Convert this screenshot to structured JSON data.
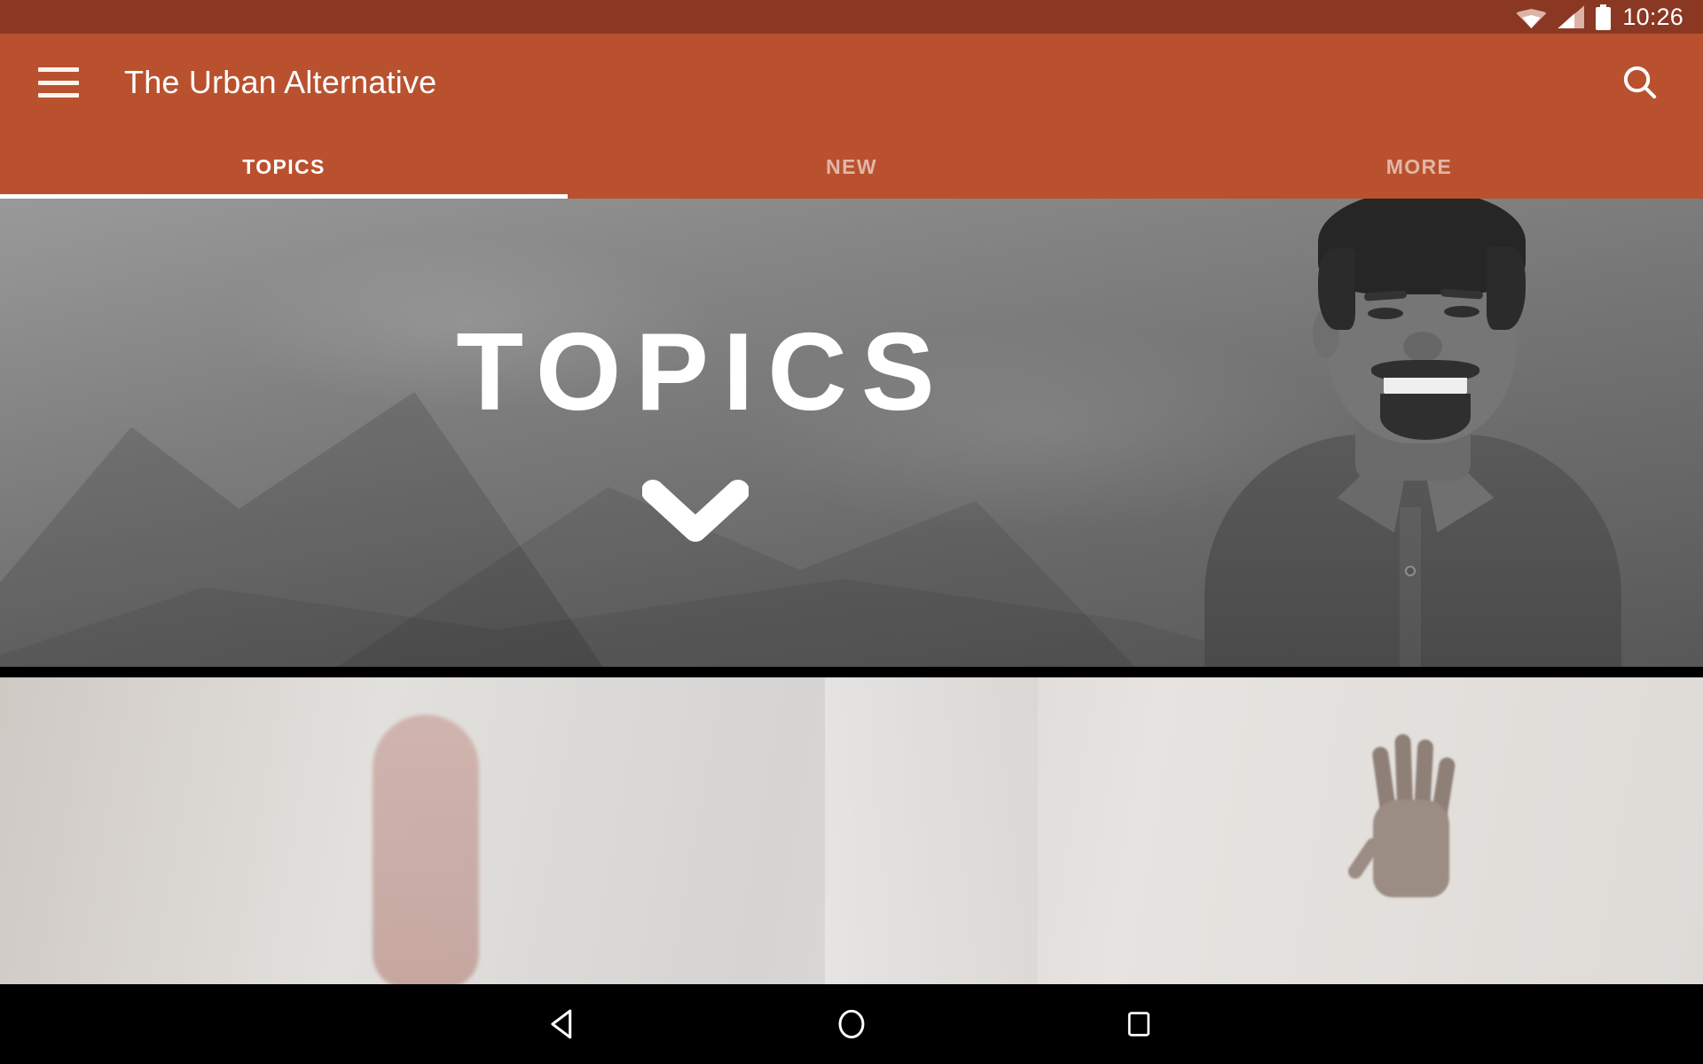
{
  "status_bar": {
    "time": "10:26",
    "icons": [
      "wifi-icon",
      "cellular-signal-icon",
      "battery-icon"
    ],
    "background_color": "#8A3823"
  },
  "app_bar": {
    "title": "The Urban Alternative",
    "menu_icon": "hamburger-menu-icon",
    "search_icon": "search-icon",
    "background_color": "#B9512F",
    "tabs": [
      {
        "label": "TOPICS",
        "active": true
      },
      {
        "label": "NEW",
        "active": false
      },
      {
        "label": "MORE",
        "active": false
      }
    ]
  },
  "hero": {
    "title": "TOPICS",
    "expand_icon": "chevron-down-icon",
    "image_description": "grayscale mountain landscape with portrait of smiling man"
  },
  "second_card": {
    "image_description": "washed out light photo with raised hand"
  },
  "nav_bar": {
    "buttons": [
      {
        "name": "back-button",
        "icon": "triangle-left-icon"
      },
      {
        "name": "home-button",
        "icon": "circle-icon"
      },
      {
        "name": "recents-button",
        "icon": "square-icon"
      }
    ],
    "background_color": "#000000"
  }
}
